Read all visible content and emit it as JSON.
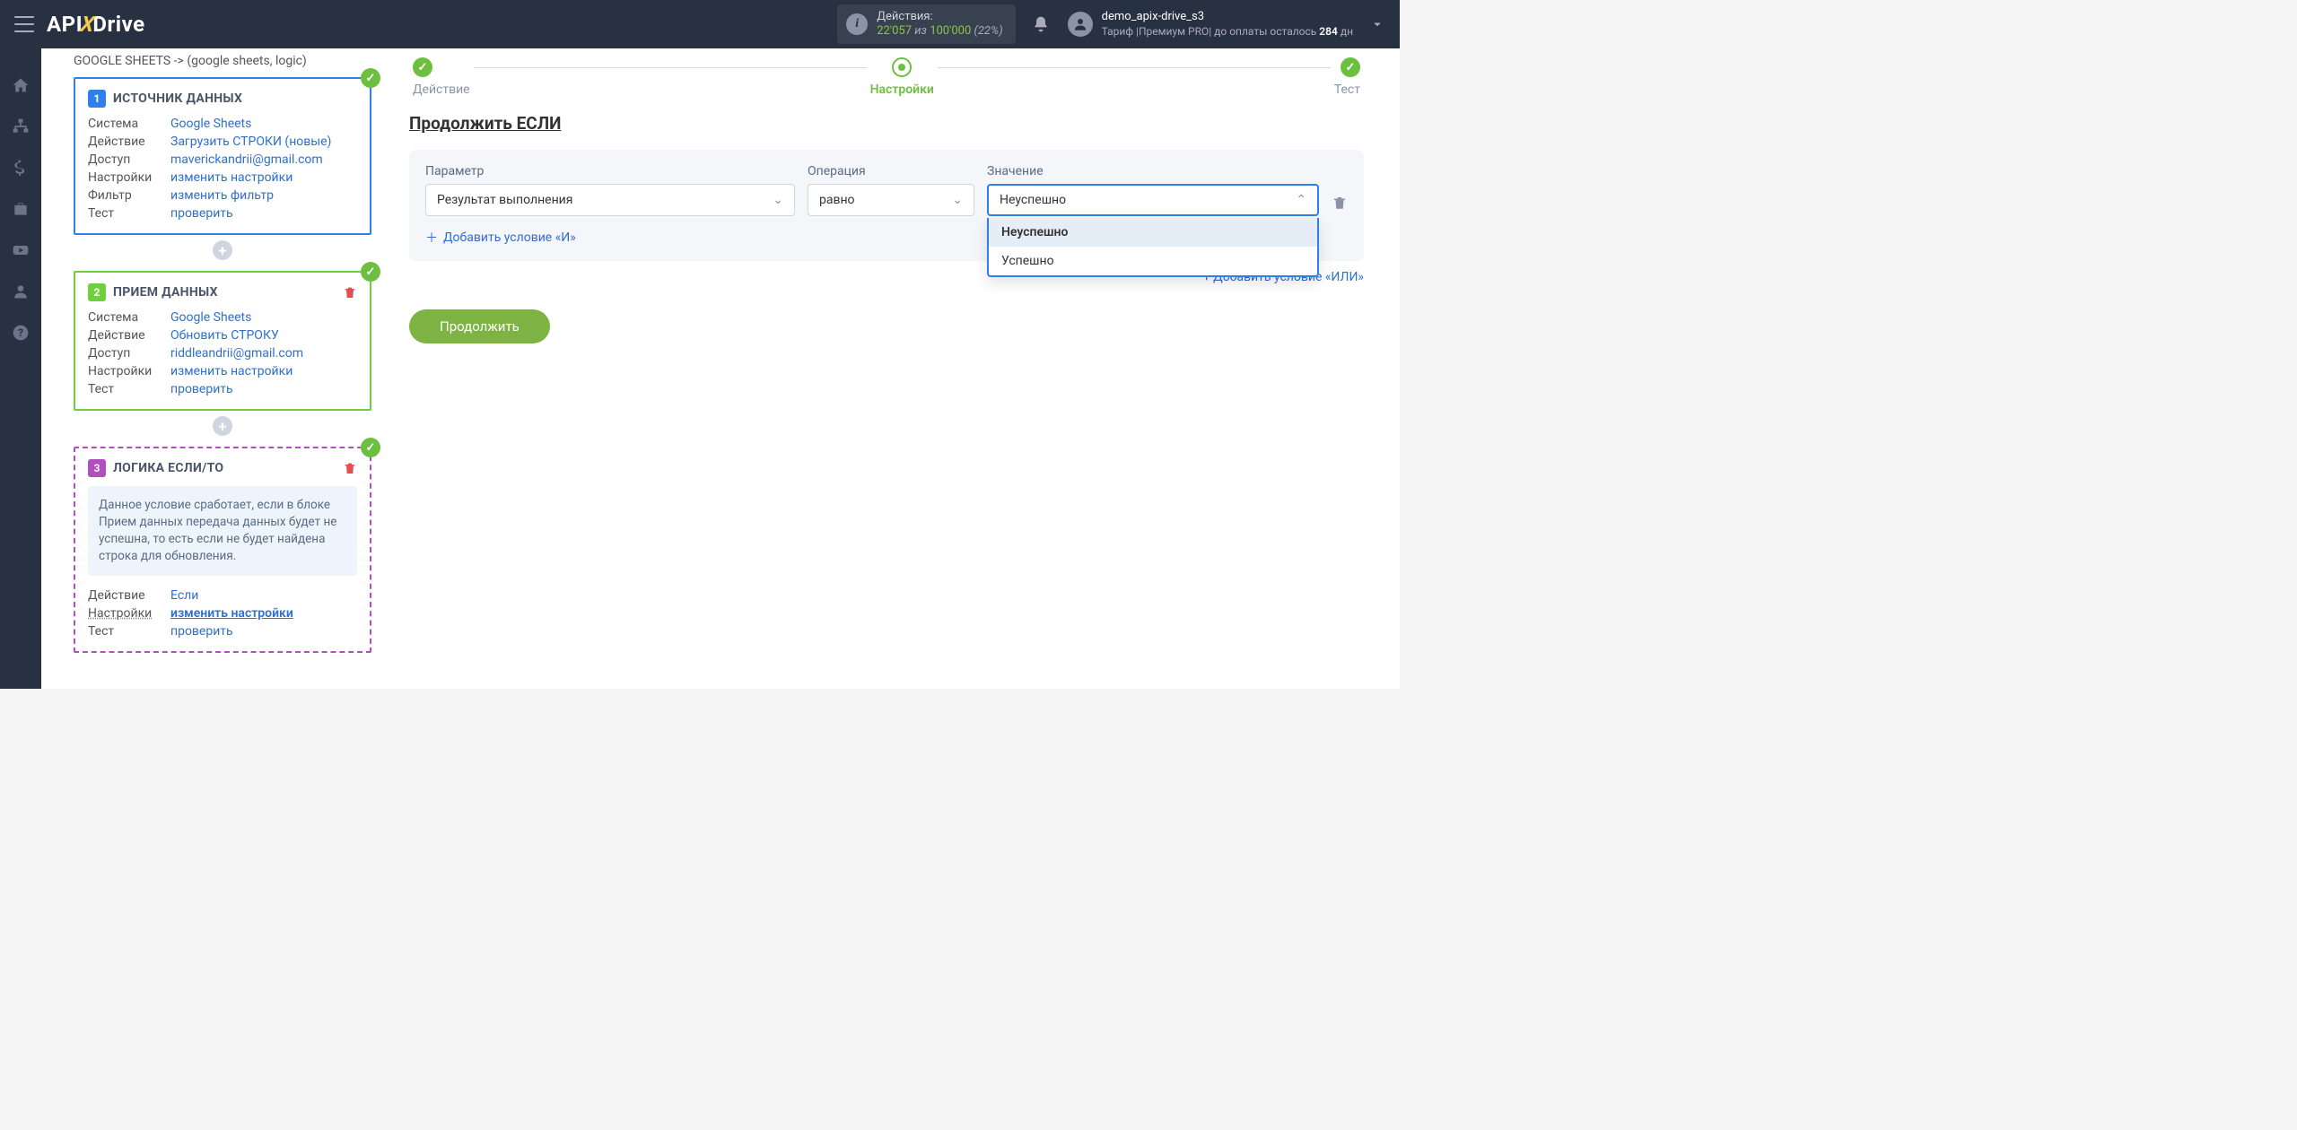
{
  "brand": {
    "part1": "API",
    "part2": "X",
    "part3": "Drive"
  },
  "topbar": {
    "actions_label": "Действия:",
    "actions_used": "22'057",
    "actions_of": "из",
    "actions_total": "100'000",
    "actions_pct": "(22%)",
    "username": "demo_apix-drive_s3",
    "tariff_prefix": "Тариф |Премиум PRO| до оплаты осталось ",
    "tariff_days": "284",
    "tariff_suffix": " дн"
  },
  "breadcrumb": "GOOGLE SHEETS -> (google sheets, logic)",
  "cards": {
    "c1": {
      "num": "1",
      "title": "ИСТОЧНИК ДАННЫХ",
      "rows": {
        "system_k": "Система",
        "system_v": "Google Sheets",
        "action_k": "Действие",
        "action_v": "Загрузить СТРОКИ (новые)",
        "access_k": "Доступ",
        "access_v": "maverickandrii@gmail.com",
        "settings_k": "Настройки",
        "settings_v": "изменить настройки",
        "filter_k": "Фильтр",
        "filter_v": "изменить фильтр",
        "test_k": "Тест",
        "test_v": "проверить"
      }
    },
    "c2": {
      "num": "2",
      "title": "ПРИЕМ ДАННЫХ",
      "rows": {
        "system_k": "Система",
        "system_v": "Google Sheets",
        "action_k": "Действие",
        "action_v": "Обновить СТРОКУ",
        "access_k": "Доступ",
        "access_v": "riddleandrii@gmail.com",
        "settings_k": "Настройки",
        "settings_v": "изменить настройки",
        "test_k": "Тест",
        "test_v": "проверить"
      }
    },
    "c3": {
      "num": "3",
      "title": "ЛОГИКА ЕСЛИ/ТО",
      "desc": "Данное условие сработает, если в блоке Прием данных передача данных будет не успешна, то есть если не будет найдена строка для обновления.",
      "rows": {
        "action_k": "Действие",
        "action_v": "Если",
        "settings_k": "Настройки",
        "settings_v": "изменить настройки",
        "test_k": "Тест",
        "test_v": "проверить"
      }
    }
  },
  "stepper": {
    "s1": "Действие",
    "s2": "Настройки",
    "s3": "Тест"
  },
  "main": {
    "section_title": "Продолжить ЕСЛИ",
    "labels": {
      "param": "Параметр",
      "op": "Операция",
      "val": "Значение"
    },
    "param_value": "Результат выполнения",
    "op_value": "равно",
    "val_value": "Неуспешно",
    "dropdown": {
      "opt1": "Неуспешно",
      "opt2": "Успешно"
    },
    "add_and": "Добавить условие «И»",
    "add_or": "+ Добавить условие «ИЛИ»",
    "continue": "Продолжить"
  }
}
